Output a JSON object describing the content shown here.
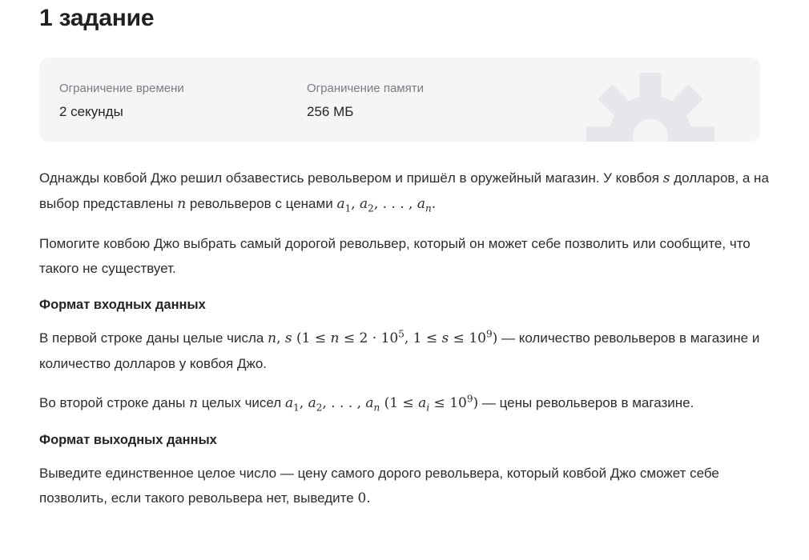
{
  "title": "1 задание",
  "limits": {
    "time_label": "Ограничение времени",
    "time_value": "2 секунды",
    "memory_label": "Ограничение памяти",
    "memory_value": "256 МБ"
  },
  "statement": {
    "p1_a": "Однажды ковбой Джо решил обзавестись револьвером и пришёл в оружейный магазин. У ковбоя",
    "p1_b": "долларов, а на выбор представлены",
    "p1_c": "револьверов с ценами",
    "p2": "Помогите ковбою Джо выбрать самый дорогой револьвер, который он может себе позволить или сообщите, что такого не существует."
  },
  "input_section": {
    "heading": "Формат входных данных",
    "p1_a": "В первой строке даны целые числа",
    "p1_b": "— количество револьверов в магазине и количество долларов у ковбоя Джо.",
    "p2_a": "Во второй строке даны",
    "p2_b": "целых чисел",
    "p2_c": "— цены револьверов в магазине."
  },
  "output_section": {
    "heading": "Формат выходных данных",
    "p1_a": "Выведите единственное целое число — цену самого дорого револьвера, который ковбой Джо сможет себе позволить, если такого револьвера нет, выведите"
  }
}
